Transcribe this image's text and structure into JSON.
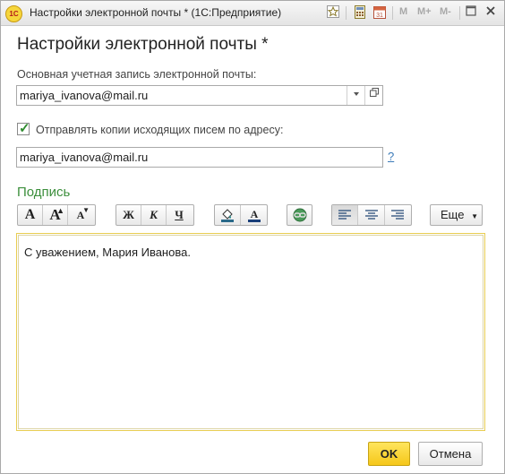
{
  "window": {
    "title": "Настройки электронной почты * (1С:Предприятие)",
    "logo_text": "1С",
    "memory_buttons": [
      "M",
      "M+",
      "M-"
    ]
  },
  "icons": {
    "favorite": "star-icon",
    "calculator": "calculator-icon",
    "calendar": "calendar-icon",
    "minimize": "minimize-icon",
    "maximize": "maximize-icon",
    "close": "close-icon",
    "dropdown": "chevron-down-icon",
    "open": "open-window-icon"
  },
  "form": {
    "heading": "Настройки электронной почты *",
    "account_label": "Основная учетная запись электронной почты:",
    "account_value": "mariya_ivanova@mail.ru",
    "copy_checkbox_checked": true,
    "copy_checkbox_label": "Отправлять копии исходящих писем по адресу:",
    "copy_address_value": "mariya_ivanova@mail.ru",
    "help_link": "?"
  },
  "signature": {
    "section_title": "Подпись",
    "toolbar": {
      "font_size_normal": "A",
      "font_size_increase": "A",
      "font_size_decrease": "A",
      "bold": "Ж",
      "italic": "К",
      "underline": "Ч",
      "more": "Еще"
    },
    "text": "С уважением, Мария Иванова."
  },
  "buttons": {
    "ok": "OK",
    "cancel": "Отмена"
  },
  "colors": {
    "accent_green": "#3c8f3c",
    "ok_button": "#f5c71a",
    "editor_border": "#e8cd52"
  }
}
